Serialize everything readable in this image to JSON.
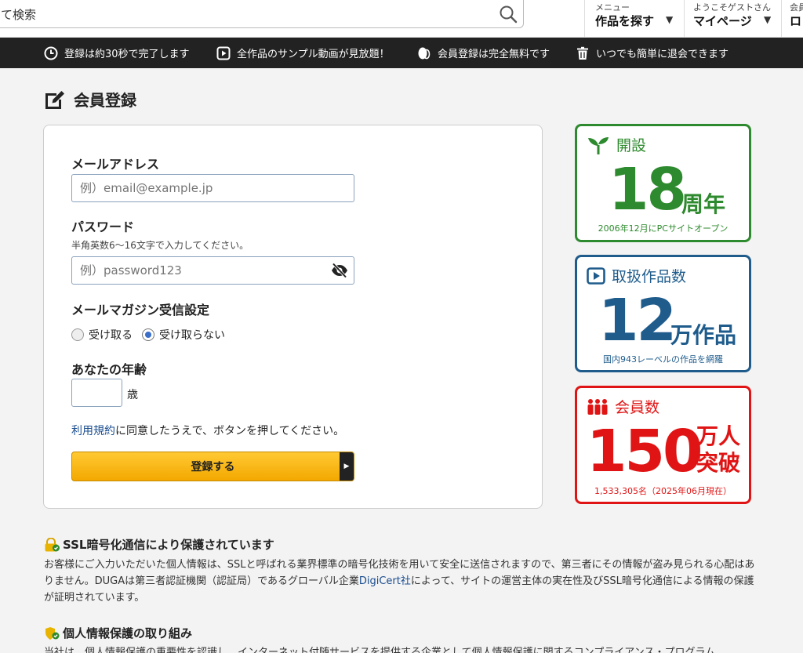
{
  "header": {
    "search_text": "て検索",
    "menu": {
      "small": "メニュー",
      "label": "作品を探す"
    },
    "mypage": {
      "small": "ようこそゲストさん",
      "label": "マイページ"
    },
    "cut": {
      "small": "会員",
      "label": "ロ"
    }
  },
  "infobar": [
    {
      "icon": "clock-icon",
      "text": "登録は約30秒で完了します"
    },
    {
      "icon": "play-icon",
      "text": "全作品のサンプル動画が見放題！"
    },
    {
      "icon": "coin-icon",
      "text": "会員登録は完全無料です"
    },
    {
      "icon": "trash-icon",
      "text": "いつでも簡単に退会できます"
    }
  ],
  "page_title": "会員登録",
  "form": {
    "email_label": "メールアドレス",
    "email_placeholder": "例）email@example.jp",
    "password_label": "パスワード",
    "password_hint": "半角英数6〜16文字で入力してください。",
    "password_placeholder": "例）password123",
    "magazine_label": "メールマガジン受信設定",
    "magazine_options": [
      "受け取る",
      "受け取らない"
    ],
    "magazine_selected": "受け取らない",
    "age_label": "あなたの年齢",
    "age_unit": "歳",
    "terms_link": "利用規約",
    "terms_rest": "に同意したうえで、ボタンを押してください。",
    "submit_label": "登録する"
  },
  "stats": {
    "anniversary": {
      "title": "開設",
      "number": "18",
      "unit": "周年",
      "foot": "2006年12月にPCサイトオープン",
      "color": "#2e8a2e"
    },
    "works": {
      "title": "取扱作品数",
      "number": "12",
      "unit": "万作品",
      "foot": "国内943レーベルの作品を網羅",
      "color": "#1f5c8c"
    },
    "members": {
      "title": "会員数",
      "number": "150",
      "unit1": "万人",
      "unit2": "突破",
      "foot": "1,533,305名（2025年06月現在）",
      "color": "#e01414"
    }
  },
  "ssl": {
    "title": "SSL暗号化通信により保護されています",
    "body1": "お客様にご入力いただいた個人情報は、SSLと呼ばれる業界標準の暗号化技術を用いて安全に送信されますので、第三者にその情報が盗み見られる心配はありません。DUGAは第三者認証機関（認証局）であるグローバル企業",
    "link": "DigiCert社",
    "body2": "によって、サイトの運営主体の実在性及びSSL暗号化通信による情報の保護が証明されています。"
  },
  "privacy": {
    "title": "個人情報保護の取り組み",
    "body": "当社は、個人情報保護の重要性を認識し、インターネット付随サービスを提供する企業として個人情報保護に関するコンプライアンス・プログラム"
  }
}
